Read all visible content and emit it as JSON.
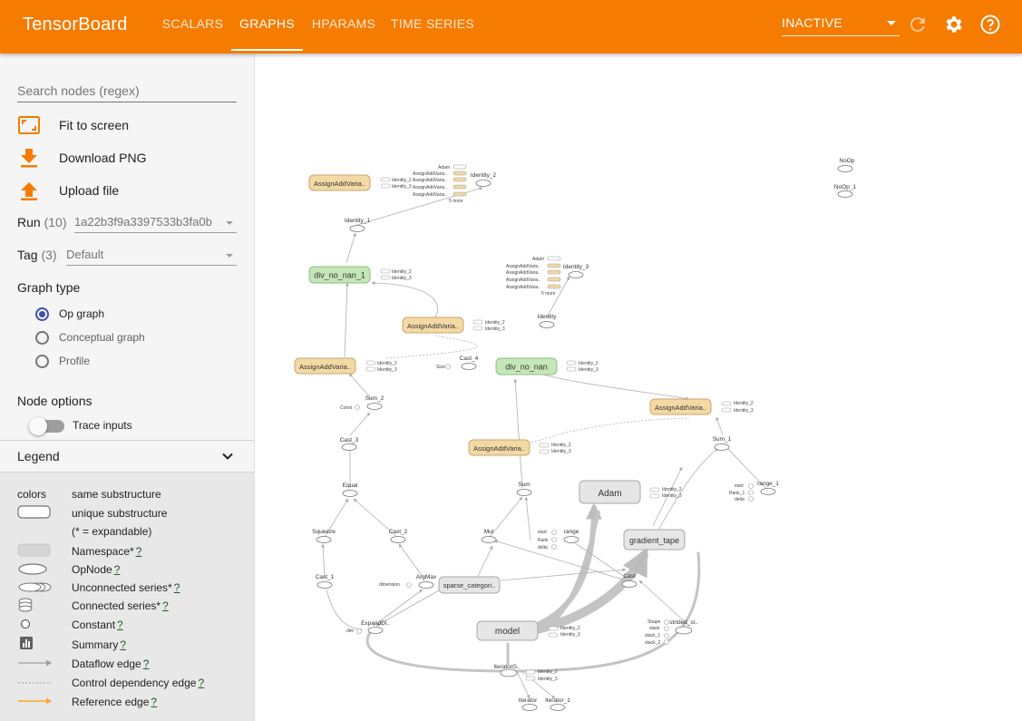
{
  "app": {
    "title": "TensorBoard",
    "tabs": [
      {
        "label": "SCALARS",
        "active": false
      },
      {
        "label": "GRAPHS",
        "active": true
      },
      {
        "label": "HPARAMS",
        "active": false
      },
      {
        "label": "TIME SERIES",
        "active": false
      }
    ],
    "status_select": "INACTIVE",
    "icons": [
      "refresh-icon",
      "settings-icon",
      "help-icon"
    ],
    "brand_color": "#f57c00"
  },
  "sidebar": {
    "search_placeholder": "Search nodes (regex)",
    "actions": [
      {
        "label": "Fit to screen",
        "icon": "fit-screen-icon"
      },
      {
        "label": "Download PNG",
        "icon": "download-icon"
      },
      {
        "label": "Upload file",
        "icon": "upload-icon"
      }
    ],
    "run": {
      "label": "Run",
      "count": "(10)",
      "value": "1a22b3f9a3397533b3fa0b"
    },
    "tag": {
      "label": "Tag",
      "count": "(3)",
      "value": "Default"
    },
    "graph_type": {
      "title": "Graph type",
      "options": [
        {
          "label": "Op graph",
          "selected": true
        },
        {
          "label": "Conceptual graph",
          "selected": false
        },
        {
          "label": "Profile",
          "selected": false
        }
      ]
    },
    "node_options": {
      "title": "Node options",
      "trace_inputs_label": "Trace inputs",
      "trace_inputs_on": false
    },
    "legend": {
      "title": "Legend",
      "colors_label": "colors",
      "colors_value": "same substructure",
      "items": [
        {
          "label": "unique substructure",
          "help": ""
        },
        {
          "label": "(* = expandable)",
          "help": ""
        },
        {
          "label": "Namespace*",
          "help": "?"
        },
        {
          "label": "OpNode",
          "help": "?"
        },
        {
          "label": "Unconnected series*",
          "help": "?"
        },
        {
          "label": "Connected series*",
          "help": "?"
        },
        {
          "label": "Constant",
          "help": "?"
        },
        {
          "label": "Summary",
          "help": "?"
        },
        {
          "label": "Dataflow edge",
          "help": "?"
        },
        {
          "label": "Control dependency edge",
          "help": "?"
        },
        {
          "label": "Reference edge",
          "help": "?"
        }
      ]
    }
  },
  "graph": {
    "namespace_nodes": [
      {
        "id": "assign_top",
        "label": "AssignAddVaria..",
        "fill": "#f3d9a4"
      },
      {
        "id": "div_no_nan_1",
        "label": "div_no_nan_1",
        "fill": "#c5e6b8"
      },
      {
        "id": "assign_mid",
        "label": "AssignAddVaria..",
        "fill": "#f3d9a4"
      },
      {
        "id": "assign_left",
        "label": "AssignAddVaria..",
        "fill": "#f3d9a4"
      },
      {
        "id": "div_no_nan",
        "label": "div_no_nan",
        "fill": "#c5e6b8"
      },
      {
        "id": "assign_right",
        "label": "AssignAddVaria..",
        "fill": "#f3d9a4"
      },
      {
        "id": "assign_center",
        "label": "AssignAddVaria..",
        "fill": "#f3d9a4"
      },
      {
        "id": "adam",
        "label": "Adam",
        "fill": "#e6e6e6"
      },
      {
        "id": "gradient_tape",
        "label": "gradient_tape",
        "fill": "#e6e6e6"
      },
      {
        "id": "sparse",
        "label": "sparse_categori..",
        "fill": "#e6e6e6"
      },
      {
        "id": "model",
        "label": "model",
        "fill": "#e6e6e6"
      }
    ],
    "op_nodes": [
      "Identity_1",
      "Identity_2",
      "Identity_3",
      "Identity",
      "Cast_4",
      "Sum_2",
      "Cast_3",
      "Equal",
      "Squeeze",
      "Cast_2",
      "Cast_1",
      "ArgMax",
      "ExpandDi..",
      "Sum",
      "Mul",
      "range",
      "Sum_1",
      "range_1",
      "Cast",
      "strided_sl..",
      "IteratorG..",
      "Iterator",
      "Iterator_1",
      "NoOp",
      "NoOp_1"
    ],
    "small_labels": {
      "identity_2": "Identity_2",
      "identity_3": "Identity_3",
      "adam": "Adam",
      "assign": "AssignAddVaria..",
      "more": "5 more",
      "size": "Size",
      "const": "Const",
      "dimension": "dimension",
      "dim": "dim",
      "start": "start",
      "rank": "Rank",
      "delta": "delta",
      "rank_1": "Rank_1",
      "shape": "Shape",
      "stack": "stack",
      "stack_1": "stack_1",
      "stack_2": "stack_2"
    },
    "edge_color": "#aaaaaa",
    "tensor_edge_color": "#bdbdbd"
  }
}
